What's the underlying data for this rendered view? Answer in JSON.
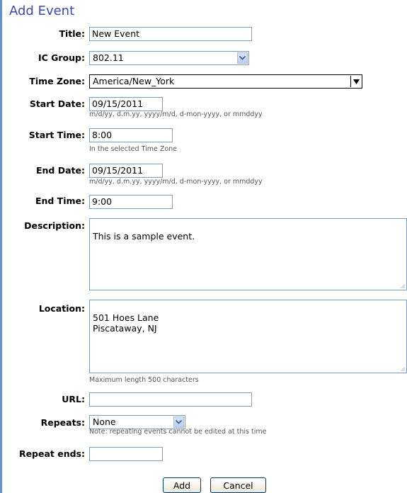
{
  "page_title": "Add Event",
  "fields": {
    "title": {
      "label": "Title:",
      "value": "New Event"
    },
    "ic_group": {
      "label": "IC Group:",
      "value": "802.11"
    },
    "time_zone": {
      "label": "Time Zone:",
      "value": "America/New_York"
    },
    "start_date": {
      "label": "Start Date:",
      "value": "09/15/2011",
      "hint": "m/d/yy, d.m.yy, yyyy/m/d, d-mon-yyyy, or mmddyy"
    },
    "start_time": {
      "label": "Start Time:",
      "value": "8:00",
      "hint": "In the selected Time Zone"
    },
    "end_date": {
      "label": "End Date:",
      "value": "09/15/2011",
      "hint": "m/d/yy, d.m.yy, yyyy/m/d, d-mon-yyyy, or mmddyy"
    },
    "end_time": {
      "label": "End Time:",
      "value": "9:00"
    },
    "description": {
      "label": "Description:",
      "value": "This is a sample event."
    },
    "location": {
      "label": "Location:",
      "value": "501 Hoes Lane\nPiscataway, NJ",
      "hint": "Maximum length 500 characters"
    },
    "url": {
      "label": "URL:",
      "value": ""
    },
    "repeats": {
      "label": "Repeats:",
      "value": "None",
      "hint": "Note: repeating events cannot be edited at this time"
    },
    "repeat_ends": {
      "label": "Repeat ends:",
      "value": ""
    }
  },
  "buttons": {
    "add": "Add",
    "cancel": "Cancel"
  },
  "colors": {
    "title": "#3949b0",
    "accent_bar": "#6b8fc9",
    "input_border": "#7f9db9"
  }
}
